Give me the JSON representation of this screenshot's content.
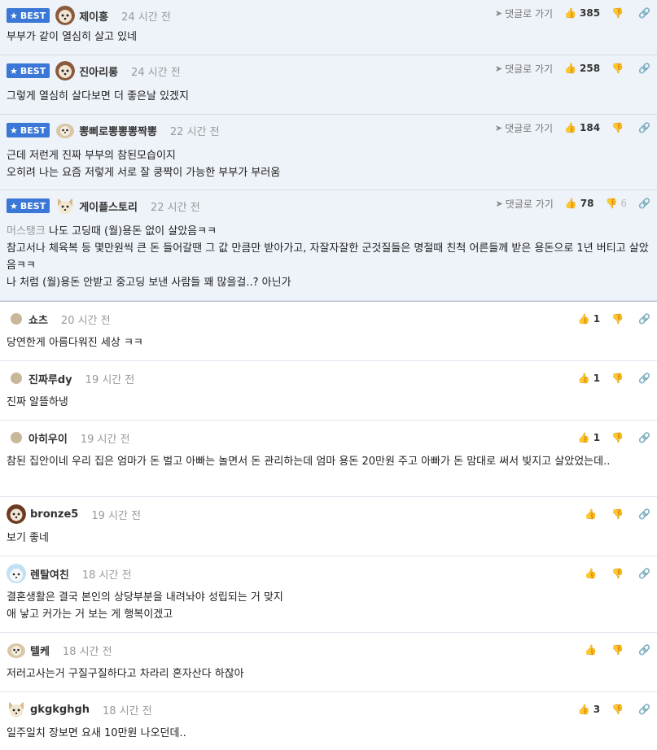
{
  "best_label": "BEST",
  "reply_label": "댓글로 가기",
  "best_comments": [
    {
      "nick": "제이홍",
      "time": "24 시간 전",
      "up": "385",
      "down": "",
      "text": "부부가 같이 열심히 살고 있네",
      "height": 68
    },
    {
      "nick": "진아리롱",
      "time": "24 시간 전",
      "up": "258",
      "down": "",
      "text": "그렇게 열심히 살다보면 더 좋은날 있겠지",
      "height": 73
    },
    {
      "nick": "뽕삐로뽕뽕뽕짝뽕",
      "time": "22 시간 전",
      "up": "184",
      "down": "",
      "text": "근데 저런게 진짜 부부의 참된모습이지\n오히려 나는 요즘 저렇게 서로 잘 쿵짝이 가능한 부부가 부러움",
      "height": 93
    },
    {
      "nick": "게이플스토리",
      "time": "22 시간 전",
      "up": "78",
      "down": "6",
      "mention": "머스탱크",
      "text": "나도 고딩때 (월)용돈 없이 살았음ㅋㅋ\n참고서나 체육복 등 몇만원씩 큰 돈 들어갈땐 그 값 만큼만 받아가고, 자잘자잘한 군것질들은 명절때 친척 어른들께 받은 용돈으로 1년 버티고 살았음ㅋㅋ\n나 처럼 (월)용돈 안받고 중고딩 보낸 사람들 꽤 많을걸..? 아닌가",
      "height": 136
    }
  ],
  "comments": [
    {
      "nick": "쇼츠",
      "time": "20 시간 전",
      "up": "1",
      "text": "당연한게 아름다워진 세상 ㅋㅋ",
      "height": 73
    },
    {
      "nick": "진짜루dy",
      "time": "19 시간 전",
      "up": "1",
      "text": "진짜 알뜰하냉",
      "height": 73
    },
    {
      "nick": "아히우이",
      "time": "19 시간 전",
      "up": "1",
      "text": "참된 집안이네 우리 집은 엄마가 돈 벌고 아빠는 놀면서 돈 관리하는데 엄마 용돈 20만원 주고 아빠가 돈 맘대로 써서 빚지고 살았었는데..",
      "height": 94
    },
    {
      "nick": "bronze5",
      "time": "19 시간 전",
      "up": "",
      "text": "보기 좋네",
      "height": 73
    },
    {
      "nick": "렌탈여친",
      "time": "18 시간 전",
      "up": "",
      "text": "결혼생활은 결국 본인의 상당부분을 내려놔야 성립되는 거 맞지\n애 낳고 커가는 거 보는 게 행복이겠고",
      "height": 94
    },
    {
      "nick": "텔케",
      "time": "18 시간 전",
      "up": "",
      "text": "저러고사는거 구질구질하다고 차라리 혼자산다 하잖아",
      "height": 73
    },
    {
      "nick": "gkgkghgh",
      "time": "18 시간 전",
      "up": "3",
      "text": "일주일치 장보면 요새 10만원 나오던데..",
      "height": 71
    }
  ],
  "colors": {
    "best_bg": "#eef2f9",
    "badge": "#3a77d6",
    "muted": "#999999"
  }
}
